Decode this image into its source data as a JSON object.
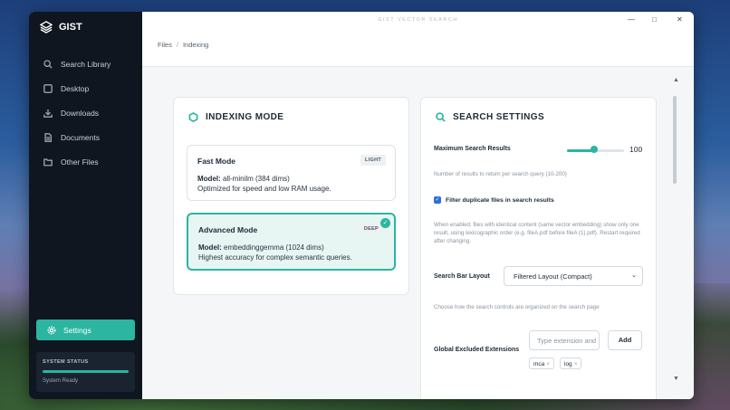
{
  "app": {
    "name": "GIST",
    "window_title": "GIST VECTOR SEARCH"
  },
  "window_controls": {
    "minimize": "—",
    "maximize": "□",
    "close": "✕"
  },
  "sidebar": {
    "items": [
      {
        "label": "Search Library",
        "icon": "search-icon"
      },
      {
        "label": "Desktop",
        "icon": "desktop-icon"
      },
      {
        "label": "Downloads",
        "icon": "download-icon"
      },
      {
        "label": "Documents",
        "icon": "document-icon"
      },
      {
        "label": "Other Files",
        "icon": "folder-icon"
      }
    ],
    "settings_label": "Settings",
    "status": {
      "title": "SYSTEM STATUS",
      "text": "System Ready",
      "progress": 1.0
    }
  },
  "breadcrumb": {
    "root": "Files",
    "separator": "/",
    "current": "Indexing"
  },
  "indexing": {
    "title": "INDEXING MODE",
    "modes": [
      {
        "name": "Fast Mode",
        "badge": "LIGHT",
        "model_label": "Model:",
        "model": "all-minilm (384 dims)",
        "description": "Optimized for speed and low RAM usage.",
        "selected": false
      },
      {
        "name": "Advanced Mode",
        "badge": "DEEP",
        "model_label": "Model:",
        "model": "embeddinggemma (1024 dims)",
        "description": "Highest accuracy for complex semantic queries.",
        "selected": true
      }
    ]
  },
  "search_settings": {
    "title": "SEARCH SETTINGS",
    "max_results_label": "Maximum Search Results",
    "max_results_value": "100",
    "max_results_fraction": 0.48,
    "max_results_help": "Number of results to return per search query (10-200)",
    "filter_dup_label": "Filter duplicate files in search results",
    "filter_dup_checked": true,
    "filter_dup_help": "When enabled, files with identical content (same vector embedding) show only one result, using lexicographic order (e.g. fileA.pdf before fileA (1).pdf). Restart required after changing.",
    "layout_label": "Search Bar Layout",
    "layout_value": "Filtered Layout (Compact)",
    "layout_help": "Choose how the search controls are organized on the search page",
    "excluded_label": "Global Excluded Extensions",
    "excluded_placeholder": "Type extension and",
    "add_label": "Add",
    "tags": [
      "mca",
      "log"
    ]
  },
  "colors": {
    "accent": "#2cb5a0",
    "sidebar_bg": "#0f1620",
    "checkbox": "#2b6fd6"
  }
}
